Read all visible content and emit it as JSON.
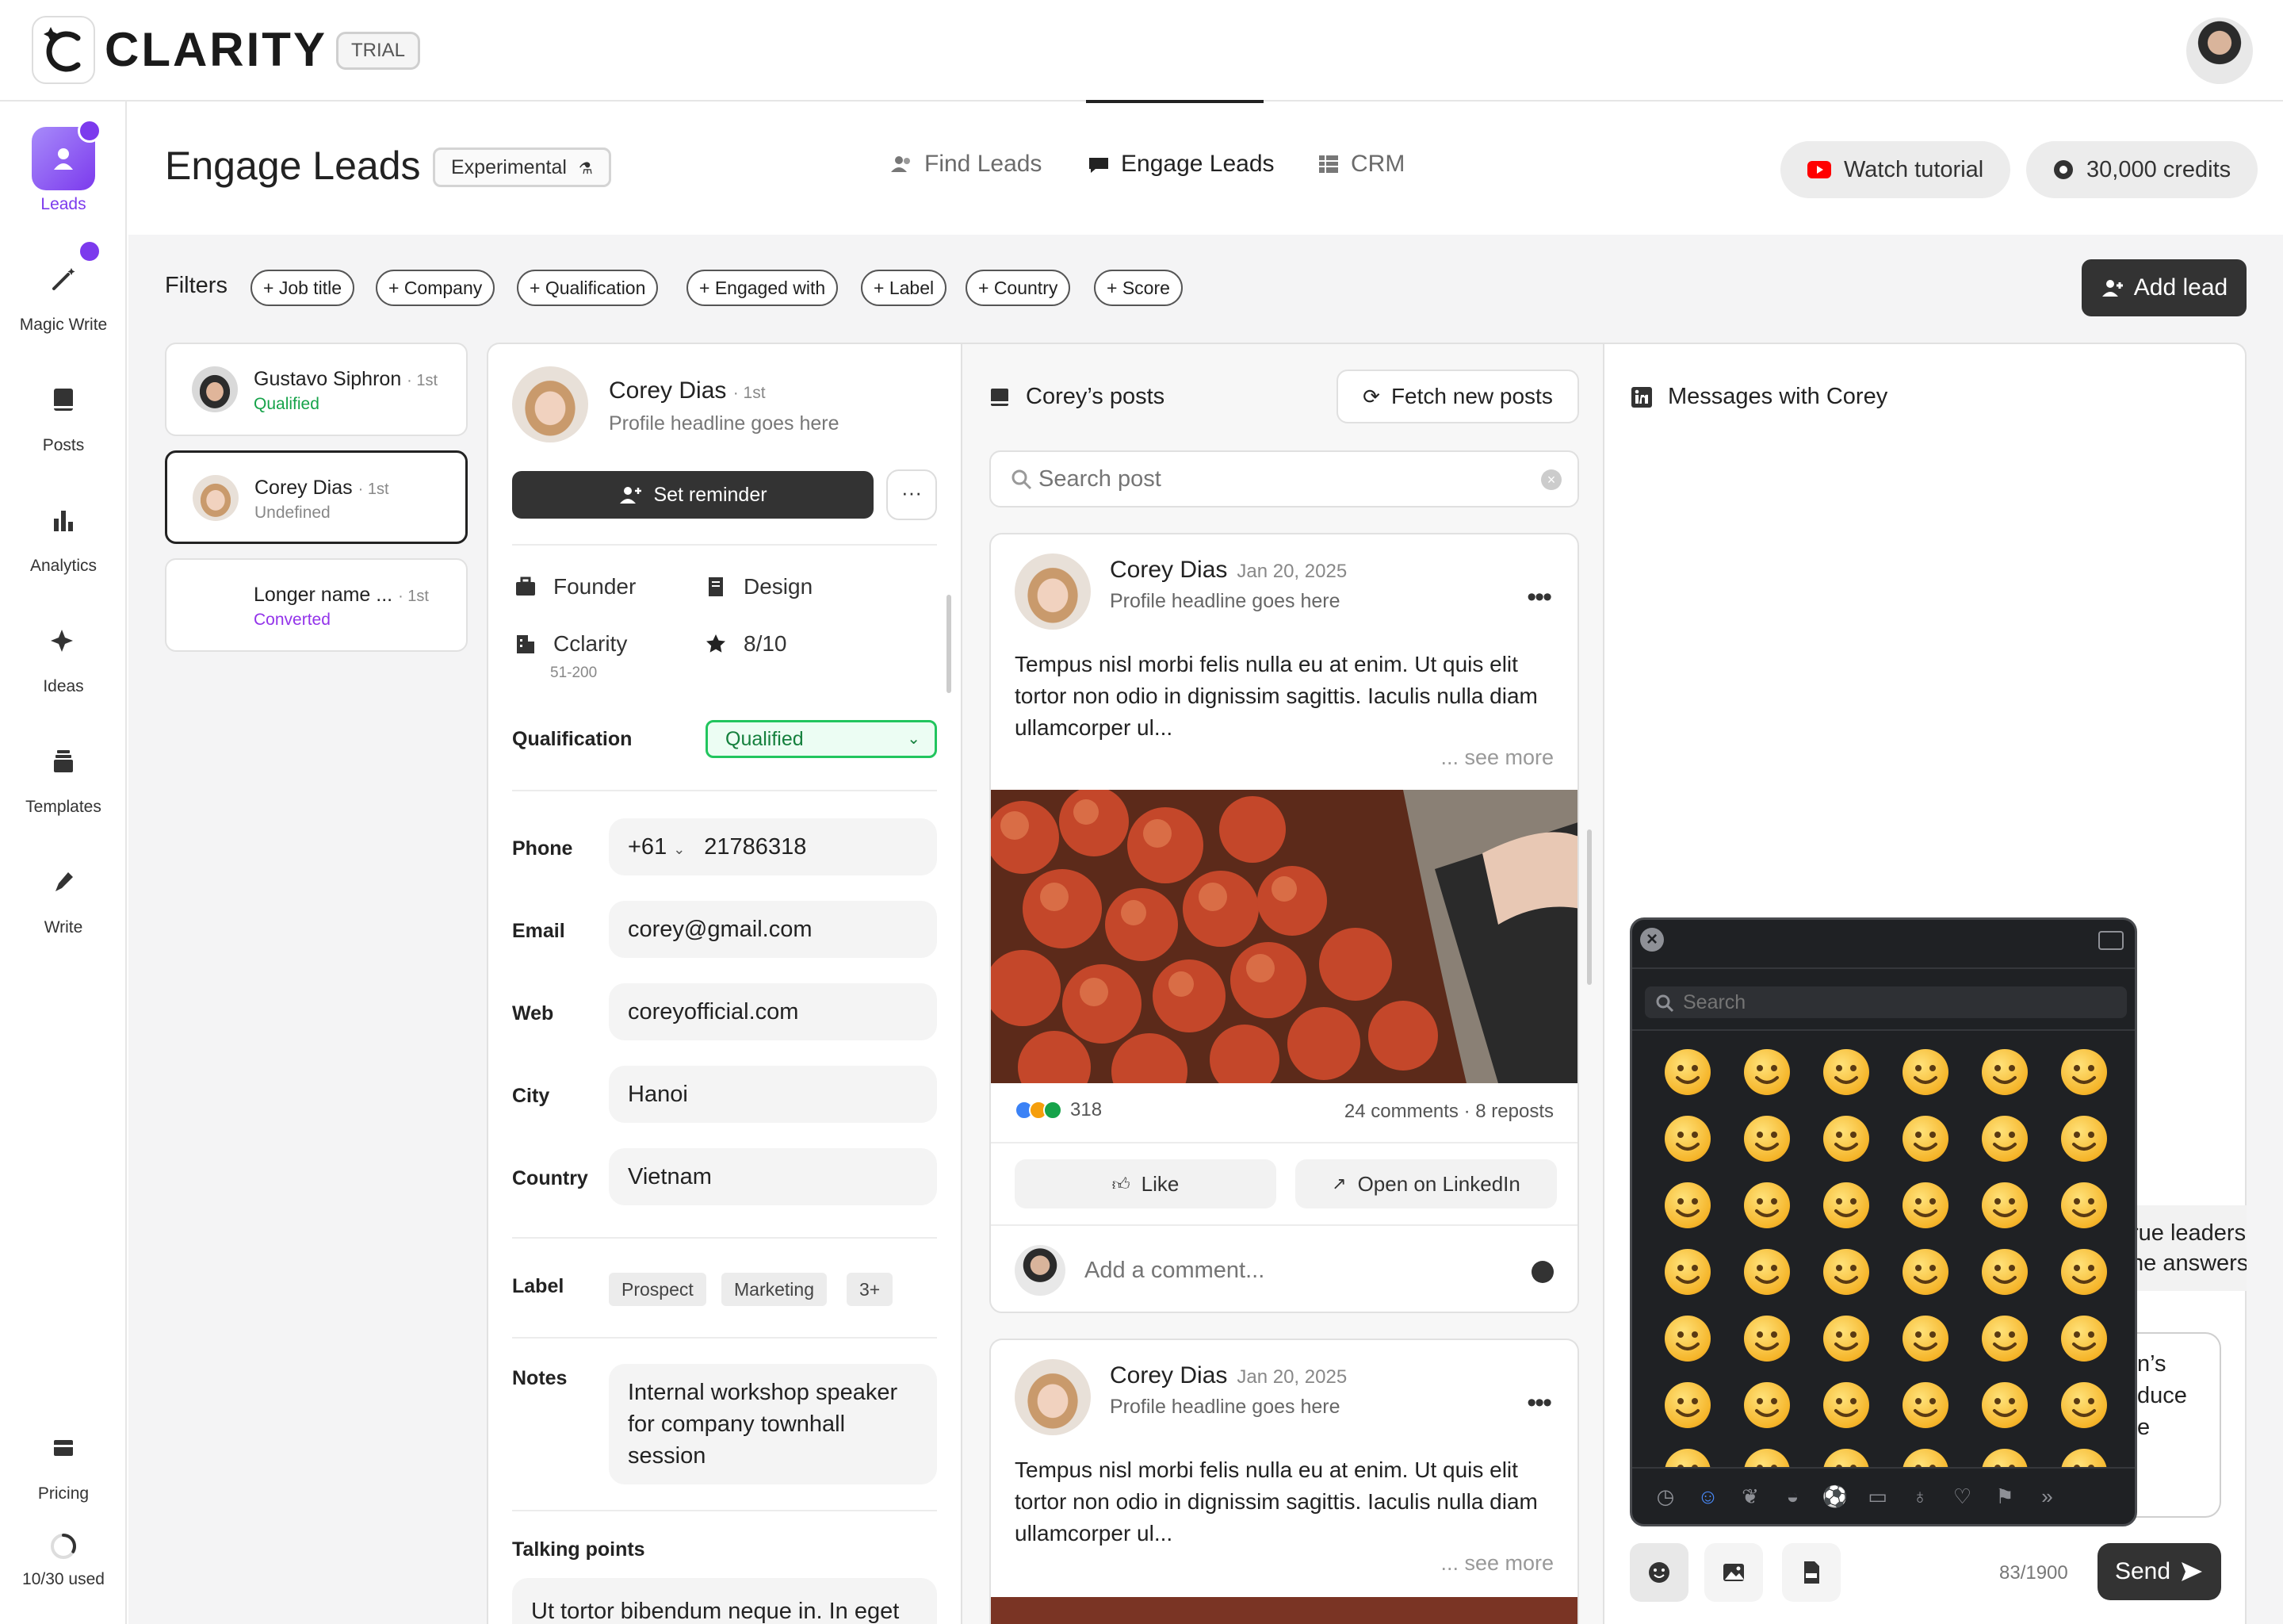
{
  "app": {
    "name": "CLARITY",
    "plan_badge": "TRIAL"
  },
  "sidebar": {
    "items": [
      {
        "label": "Leads"
      },
      {
        "label": "Magic Write"
      },
      {
        "label": "Posts"
      },
      {
        "label": "Analytics"
      },
      {
        "label": "Ideas"
      },
      {
        "label": "Templates"
      },
      {
        "label": "Write"
      }
    ],
    "pricing_label": "Pricing",
    "usage_label": "10/30 used",
    "usage_fraction": 0.33,
    "accent": "#7c3aed"
  },
  "header": {
    "title": "Engage Leads",
    "badge": "Experimental",
    "tabs": [
      {
        "label": "Find Leads",
        "active": false
      },
      {
        "label": "Engage Leads",
        "active": true
      },
      {
        "label": "CRM",
        "active": false
      }
    ],
    "watch_tutorial": "Watch tutorial",
    "credits": "30,000 credits"
  },
  "filters": {
    "label": "Filters",
    "chips": [
      "+ Job title",
      "+ Company",
      "+ Qualification",
      "+ Engaged with",
      "+ Label",
      "+ Country",
      "+ Score"
    ],
    "add_lead": "Add lead"
  },
  "leads": [
    {
      "name": "Gustavo Siphron",
      "degree": "· 1st",
      "status": "Qualified",
      "status_color": "#16a34a"
    },
    {
      "name": "Corey Dias",
      "degree": "· 1st",
      "status": "Undefined",
      "status_color": "#888888"
    },
    {
      "name": "Longer name ...",
      "degree": "· 1st",
      "status": "Converted",
      "status_color": "#9333ea"
    }
  ],
  "profile": {
    "name": "Corey Dias",
    "degree": "· 1st",
    "headline": "Profile headline goes here",
    "set_reminder": "Set reminder",
    "more": "···",
    "role": "Founder",
    "department": "Design",
    "company": "Cclarity",
    "company_size": "51-200",
    "score": "8/10",
    "qualification_label": "Qualification",
    "qualification_value": "Qualified",
    "phone_label": "Phone",
    "phone_code": "+61",
    "phone_number": "21786318",
    "email_label": "Email",
    "email": "corey@gmail.com",
    "web_label": "Web",
    "web": "coreyofficial.com",
    "city_label": "City",
    "city": "Hanoi",
    "country_label": "Country",
    "country": "Vietnam",
    "label_label": "Label",
    "labels": [
      "Prospect",
      "Marketing",
      "3+"
    ],
    "notes_label": "Notes",
    "notes": "Internal workshop speaker for company townhall session",
    "talking_points_label": "Talking points",
    "talking_points": "Ut tortor bibendum neque in. In eget"
  },
  "posts": {
    "title": "Corey’s posts",
    "fetch_button": "Fetch new posts",
    "search_placeholder": "Search post",
    "items": [
      {
        "author": "Corey Dias",
        "date": "Jan 20, 2025",
        "headline": "Profile headline goes here",
        "text": "Tempus nisl morbi felis nulla eu at enim. Ut quis elit tortor non odio in dignissim sagittis. Iaculis nulla diam ullamcorper ul...",
        "see_more": "... see more",
        "reactions": "318",
        "comments": "24 comments",
        "reposts": "· 8 reposts",
        "like": "Like",
        "open_linkedin": "Open on LinkedIn",
        "comment_placeholder": "Add a comment..."
      },
      {
        "author": "Corey Dias",
        "date": "Jan 20, 2025",
        "headline": "Profile headline goes here",
        "text": "Tempus nisl morbi felis nulla eu at enim. Ut quis elit tortor non odio in dignissim sagittis. Iaculis nulla diam ullamcorper ul...",
        "see_more": "... see more"
      }
    ]
  },
  "messages": {
    "title": "Messages with Corey",
    "bubble_partial_1": "rue leaders",
    "bubble_partial_2": "he answers",
    "draft_partial_1": "n’s",
    "draft_partial_2": "duce",
    "draft_partial_3": "e",
    "char_count": "83/1900",
    "send": "Send"
  },
  "emoji_picker": {
    "search_placeholder": "Search",
    "category_icons": [
      "clock-icon",
      "smiley-icon",
      "animal-icon",
      "food-icon",
      "ball-icon",
      "car-icon",
      "bulb-icon",
      "heart-icon",
      "flag-icon",
      "chevron-right-double-icon"
    ]
  }
}
